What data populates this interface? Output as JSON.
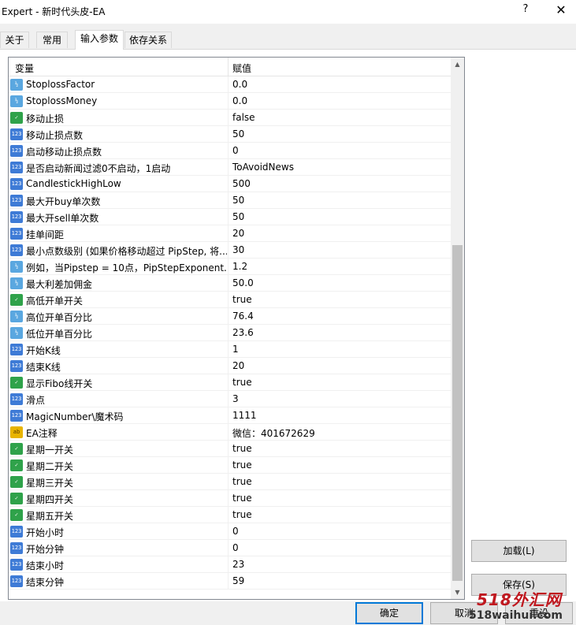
{
  "window": {
    "title": "Expert - 新时代头皮-EA",
    "help_glyph": "?",
    "close_glyph": "✕"
  },
  "tabs": [
    {
      "label": "关于"
    },
    {
      "label": "常用"
    },
    {
      "label": "输入参数"
    },
    {
      "label": "依存关系"
    }
  ],
  "grid": {
    "col_name": "变量",
    "col_value": "赋值",
    "rows": [
      {
        "icon": "dbl",
        "name": "StoplossFactor",
        "value": "0.0"
      },
      {
        "icon": "dbl",
        "name": "StoplossMoney",
        "value": "0.0"
      },
      {
        "icon": "bool",
        "name": "移动止损",
        "value": "false"
      },
      {
        "icon": "int",
        "name": "移动止损点数",
        "value": "50"
      },
      {
        "icon": "int",
        "name": "启动移动止损点数",
        "value": "0"
      },
      {
        "icon": "int",
        "name": "是否启动新闻过滤0不启动，1启动",
        "value": "ToAvoidNews"
      },
      {
        "icon": "int",
        "name": "CandlestickHighLow",
        "value": "500"
      },
      {
        "icon": "int",
        "name": "最大开buy单次数",
        "value": "50"
      },
      {
        "icon": "int",
        "name": "最大开sell单次数",
        "value": "50"
      },
      {
        "icon": "int",
        "name": "挂单间距",
        "value": "20"
      },
      {
        "icon": "int",
        "name": "最小点数级别 (如果价格移动超过 PipStep, 将...",
        "value": "30"
      },
      {
        "icon": "dbl",
        "name": "例如，当Pipstep = 10点，PipStepExponent...",
        "value": "1.2"
      },
      {
        "icon": "dbl",
        "name": "最大利差加佣金",
        "value": "50.0"
      },
      {
        "icon": "bool",
        "name": "高低开单开关",
        "value": "true"
      },
      {
        "icon": "dbl",
        "name": "高位开单百分比",
        "value": "76.4"
      },
      {
        "icon": "dbl",
        "name": "低位开单百分比",
        "value": "23.6"
      },
      {
        "icon": "int",
        "name": "开始K线",
        "value": "1"
      },
      {
        "icon": "int",
        "name": "结束K线",
        "value": "20"
      },
      {
        "icon": "bool",
        "name": "显示Fibo线开关",
        "value": "true"
      },
      {
        "icon": "int",
        "name": "滑点",
        "value": "3"
      },
      {
        "icon": "int",
        "name": "MagicNumber\\魔术码",
        "value": "1111"
      },
      {
        "icon": "str",
        "name": "EA注释",
        "value": "微信：401672629"
      },
      {
        "icon": "bool",
        "name": "星期一开关",
        "value": "true"
      },
      {
        "icon": "bool",
        "name": "星期二开关",
        "value": "true"
      },
      {
        "icon": "bool",
        "name": "星期三开关",
        "value": "true"
      },
      {
        "icon": "bool",
        "name": "星期四开关",
        "value": "true"
      },
      {
        "icon": "bool",
        "name": "星期五开关",
        "value": "true"
      },
      {
        "icon": "int",
        "name": "开始小时",
        "value": "0"
      },
      {
        "icon": "int",
        "name": "开始分钟",
        "value": "0"
      },
      {
        "icon": "int",
        "name": "结束小时",
        "value": "23"
      },
      {
        "icon": "int",
        "name": "结束分钟",
        "value": "59"
      }
    ]
  },
  "buttons": {
    "load": "加载(L)",
    "save": "保存(S)",
    "ok": "确定",
    "cancel": "取消",
    "reset": "重设"
  },
  "watermark": {
    "big": "518外汇网",
    "small": "518waihui.com"
  },
  "icon_labels": {
    "int": "123",
    "dbl": "½",
    "bool": "✓",
    "str": "ab"
  }
}
